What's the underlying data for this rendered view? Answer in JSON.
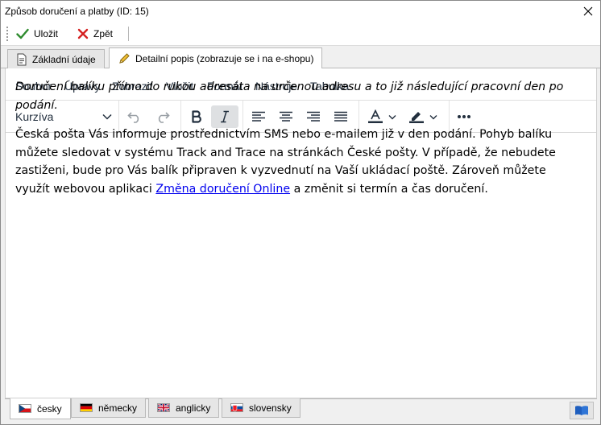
{
  "window": {
    "title": "Způsob doručení a platby  (ID: 15)"
  },
  "toolbar": {
    "save_label": "Uložit",
    "back_label": "Zpět"
  },
  "tabs": [
    {
      "label": "Základní údaje",
      "icon": "document-icon",
      "active": false
    },
    {
      "label": "Detailní popis (zobrazuje se i na e-shopu)",
      "icon": "pencil-icon",
      "active": true
    }
  ],
  "editor": {
    "menu": [
      "Soubor",
      "Úpravy",
      "Zobrazit",
      "Vložit",
      "Formát",
      "Nástroje",
      "Tabulka"
    ],
    "style_value": "Kurzíva",
    "italic_active": true,
    "content": {
      "p1": "Doručení balíku přímo do rukou adresáta na určenou adresu a to již následující pracovní den po podání.",
      "p2_before": "Česká pošta Vás informuje prostřednictvím SMS nebo e-mailem již v den podání. Pohyb balíku můžete sledovat v systému Track and Trace na stránkách České pošty. V případě, že nebudete zastiženi, bude pro Vás balík připraven k vyzvednutí na Vaší ukládací poště. Zároveň můžete využít webovou aplikaci ",
      "p2_link": "Změna doručení Online",
      "p2_after": " a změnit si termín a čas doručení."
    }
  },
  "languages": [
    {
      "label": "česky",
      "flag": "cz",
      "active": true
    },
    {
      "label": "německy",
      "flag": "de",
      "active": false
    },
    {
      "label": "anglicky",
      "flag": "gb",
      "active": false
    },
    {
      "label": "slovensky",
      "flag": "sk",
      "active": false
    }
  ],
  "colors": {
    "check_green": "#2e8b2e",
    "cross_red": "#d42020",
    "link_blue": "#0000ee",
    "book_blue": "#1f5fbf",
    "toolbar_text": "#222f3e"
  }
}
